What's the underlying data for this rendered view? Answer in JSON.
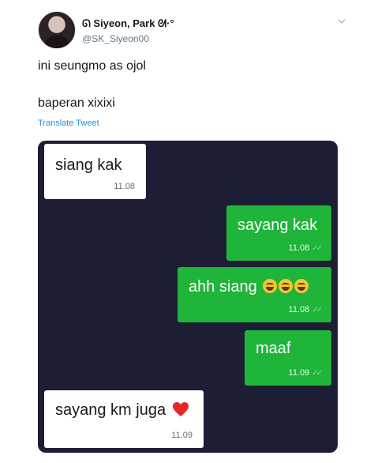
{
  "tweet": {
    "display_name": "ᘏ Siyeon, Park ᘛ·°",
    "handle": "@SK_Siyeon00",
    "line1": "ini seungmo as ojol",
    "line2": "baperan xixixi",
    "translate_label": "Translate Tweet",
    "icons": {
      "more": "chevron-down-icon",
      "avatar": "avatar"
    }
  },
  "chat": {
    "background": "#1d1e34",
    "outgoing_color": "#1eb53a",
    "incoming_color": "#ffffff",
    "messages": [
      {
        "direction": "in",
        "text": "siang kak",
        "time": "11.08"
      },
      {
        "direction": "out",
        "text": "sayang kak",
        "time": "11.08",
        "ticks": "✓✓"
      },
      {
        "direction": "out",
        "text": "ahh siang",
        "time": "11.08",
        "ticks": "✓✓",
        "emoji": [
          "laughing-emoji",
          "laughing-emoji",
          "winking-laugh-emoji"
        ]
      },
      {
        "direction": "out",
        "text": "maaf",
        "time": "11.09",
        "ticks": "✓✓"
      },
      {
        "direction": "in",
        "text": "sayang km juga",
        "time": "11.09",
        "emoji": [
          "red-heart-emoji"
        ]
      }
    ]
  }
}
